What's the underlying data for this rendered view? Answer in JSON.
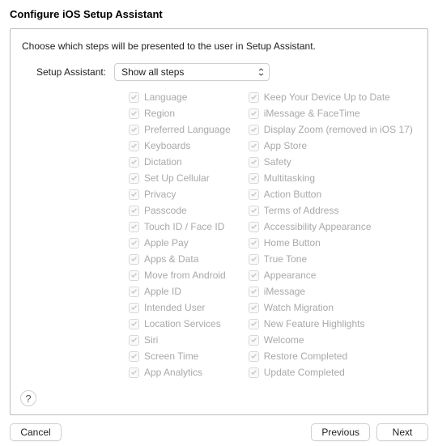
{
  "title": "Configure iOS Setup Assistant",
  "instruction": "Choose which steps will be presented to the user in Setup Assistant.",
  "selectLabel": "Setup Assistant:",
  "selectValue": "Show all steps",
  "col1": [
    "Language",
    "Region",
    "Preferred Language",
    "Keyboards",
    "Dictation",
    "Set Up Cellular",
    "Privacy",
    "Passcode",
    "Touch ID / Face ID",
    "Apple Pay",
    "Apps & Data",
    "Move from Android",
    "Apple ID",
    "Intended User",
    "Location Services",
    "Siri",
    "Screen Time",
    "App Analytics"
  ],
  "col2": [
    "Keep Your Device Up to Date",
    "iMessage & FaceTime",
    "Display Zoom (removed in iOS 17)",
    "App Store",
    "Safety",
    "Multitasking",
    "Action Button",
    "Terms of Address",
    "Accessibility Appearance",
    "Home Button",
    "True Tone",
    "Appearance",
    "iMessage",
    "Watch Migration",
    "New Feature Highlights",
    "Welcome",
    "Restore Completed",
    "Update Completed"
  ],
  "help": "?",
  "buttons": {
    "cancel": "Cancel",
    "previous": "Previous",
    "next": "Next"
  }
}
